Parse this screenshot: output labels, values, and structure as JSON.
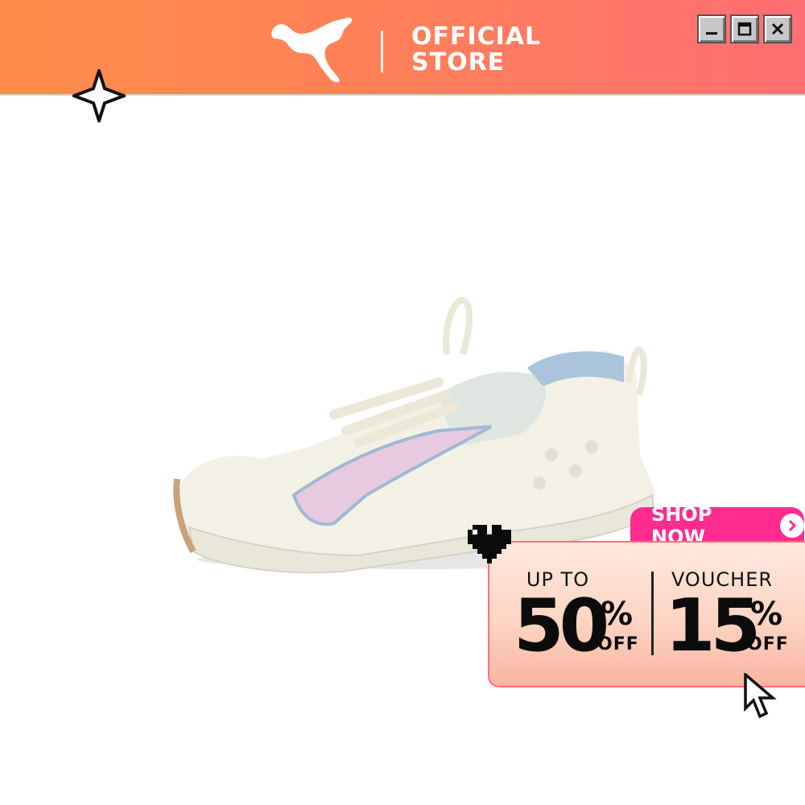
{
  "header": {
    "store_line1": "OFFICIAL",
    "store_line2": "STORE",
    "background_gradient": [
      "#ff8c4a",
      "#ff6e72"
    ]
  },
  "window_controls": {
    "minimize_icon": "minimize-icon",
    "maximize_icon": "maximize-icon",
    "close_icon": "close-icon"
  },
  "product": {
    "image": "white-sneaker-with-pink-and-blue-accents"
  },
  "promo": {
    "cta_label": "SHOP NOW",
    "left_label": "UP TO",
    "left_value": "50",
    "left_pct": "%",
    "left_off": "OFF",
    "right_label": "VOUCHER",
    "right_value": "15",
    "right_pct": "%",
    "right_off": "OFF",
    "accent": "#ff2b8e"
  }
}
